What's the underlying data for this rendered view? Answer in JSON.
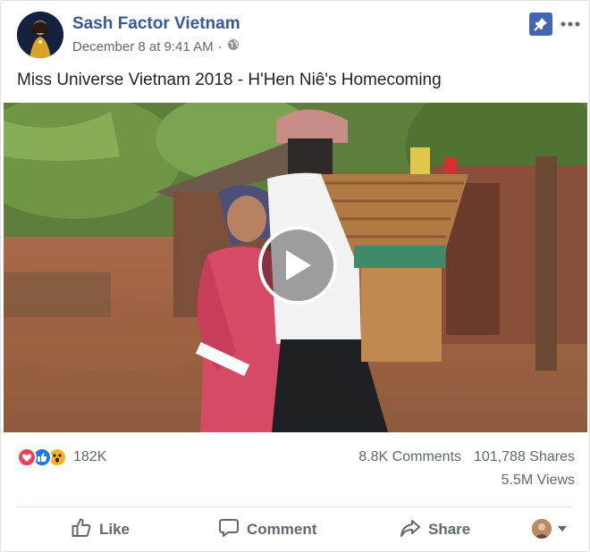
{
  "post": {
    "page_name": "Sash Factor Vietnam",
    "date": "December 8 at 9:41 AM",
    "separator": "·",
    "caption": "Miss Universe Vietnam 2018 - H'Hen Niê's Homecoming"
  },
  "stats": {
    "reaction_count": "182K",
    "comments": "8.8K Comments",
    "shares": "101,788 Shares",
    "views": "5.5M Views"
  },
  "actions": {
    "like": "Like",
    "comment": "Comment",
    "share": "Share"
  },
  "icons": {
    "globe": "globe-icon",
    "pin": "pin-icon",
    "more": "more-options-icon",
    "play": "play-icon",
    "love": "love-reaction-icon",
    "like": "like-reaction-icon",
    "wow": "wow-reaction-icon"
  },
  "colors": {
    "brand": "#385898",
    "pin_bg": "#4267b2",
    "love": "#f33e58",
    "like": "#1877f2",
    "wow": "#f7b125"
  }
}
